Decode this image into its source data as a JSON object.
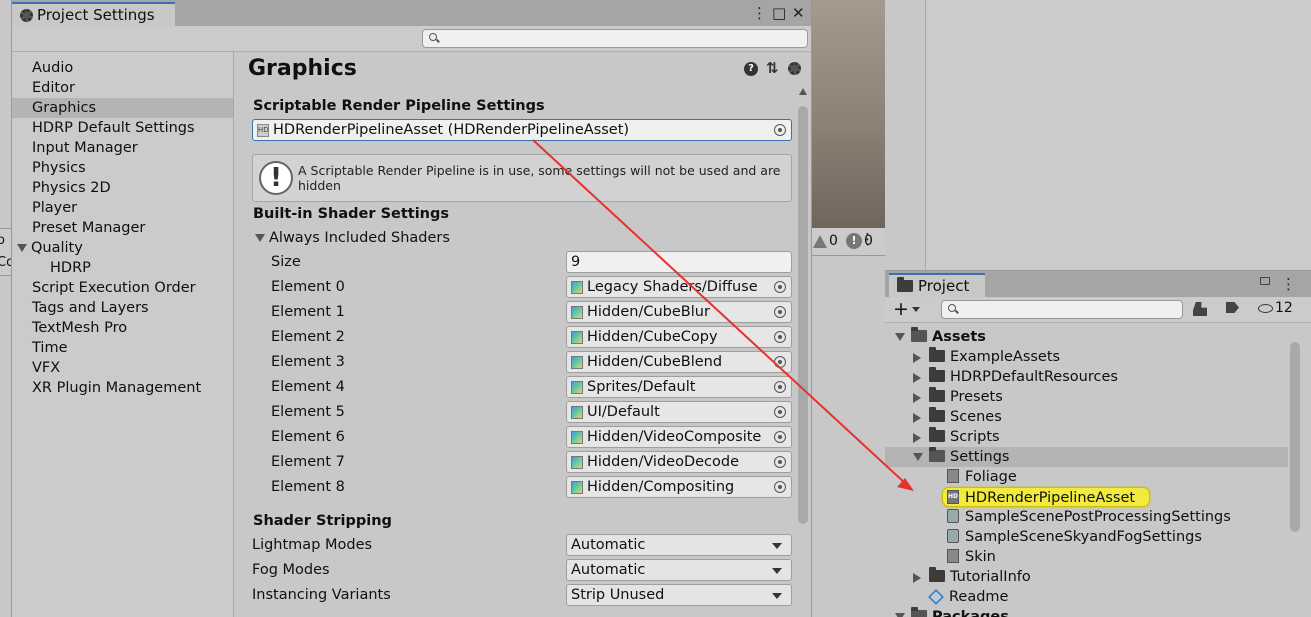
{
  "project_settings": {
    "tab_title": "Project Settings",
    "menu_glyph": "⋮",
    "maximize_glyph": "□",
    "close_glyph": "✕",
    "nav": [
      {
        "label": "Audio"
      },
      {
        "label": "Editor"
      },
      {
        "label": "Graphics",
        "selected": true
      },
      {
        "label": "HDRP Default Settings"
      },
      {
        "label": "Input Manager"
      },
      {
        "label": "Physics"
      },
      {
        "label": "Physics 2D"
      },
      {
        "label": "Player"
      },
      {
        "label": "Preset Manager"
      },
      {
        "label": "Quality",
        "expanded": true
      },
      {
        "label": "HDRP",
        "child": true
      },
      {
        "label": "Script Execution Order"
      },
      {
        "label": "Tags and Layers"
      },
      {
        "label": "TextMesh Pro"
      },
      {
        "label": "Time"
      },
      {
        "label": "VFX"
      },
      {
        "label": "XR Plugin Management"
      }
    ],
    "main": {
      "title": "Graphics",
      "help_glyph": "?",
      "preset_glyph": "⇅",
      "srp_section": "Scriptable Render Pipeline Settings",
      "srp_field": "HDRenderPipelineAsset (HDRenderPipelineAsset)",
      "help_icon_text": "!",
      "help_text": "A Scriptable Render Pipeline is in use, some settings will not be used and are hidden",
      "builtin_section": "Built-in Shader Settings",
      "always_included_label": "Always Included Shaders",
      "size_label": "Size",
      "size_value": "9",
      "elements": [
        {
          "label": "Element 0",
          "value": "Legacy Shaders/Diffuse"
        },
        {
          "label": "Element 1",
          "value": "Hidden/CubeBlur"
        },
        {
          "label": "Element 2",
          "value": "Hidden/CubeCopy"
        },
        {
          "label": "Element 3",
          "value": "Hidden/CubeBlend"
        },
        {
          "label": "Element 4",
          "value": "Sprites/Default"
        },
        {
          "label": "Element 5",
          "value": "UI/Default"
        },
        {
          "label": "Element 6",
          "value": "Hidden/VideoComposite"
        },
        {
          "label": "Element 7",
          "value": "Hidden/VideoDecode"
        },
        {
          "label": "Element 8",
          "value": "Hidden/Compositing"
        }
      ],
      "stripping_section": "Shader Stripping",
      "lightmap_label": "Lightmap Modes",
      "lightmap_value": "Automatic",
      "fog_label": "Fog Modes",
      "fog_value": "Automatic",
      "instancing_label": "Instancing Variants",
      "instancing_value": "Strip Unused"
    }
  },
  "console": {
    "warn_count": "0",
    "error_count": "0",
    "menu_glyph": "⋮"
  },
  "left_edge": {
    "line1": "o",
    "line2": "Co"
  },
  "project": {
    "tab_title": "Project",
    "add_glyph": "+",
    "hidden_count": "12",
    "tree": [
      {
        "label": "Assets",
        "kind": "folder-open",
        "bold": true
      },
      {
        "label": "ExampleAssets",
        "kind": "folder"
      },
      {
        "label": "HDRPDefaultResources",
        "kind": "folder"
      },
      {
        "label": "Presets",
        "kind": "folder"
      },
      {
        "label": "Scenes",
        "kind": "folder"
      },
      {
        "label": "Scripts",
        "kind": "folder"
      },
      {
        "label": "Settings",
        "kind": "folder-open",
        "selected": true
      },
      {
        "label": "Foliage",
        "kind": "asset"
      },
      {
        "label": "HDRenderPipelineAsset",
        "kind": "hd-asset",
        "highlighted": true
      },
      {
        "label": "SampleScenePostProcessingSettings",
        "kind": "volume"
      },
      {
        "label": "SampleSceneSkyandFogSettings",
        "kind": "volume"
      },
      {
        "label": "Skin",
        "kind": "asset"
      },
      {
        "label": "TutorialInfo",
        "kind": "folder"
      },
      {
        "label": "Readme",
        "kind": "readme"
      },
      {
        "label": "Packages",
        "kind": "folder-open",
        "bold": true
      }
    ]
  },
  "colors": {
    "accent": "#3a72b0",
    "highlight": "#f2eb3e",
    "annotation_arrow": "#e8312d"
  }
}
